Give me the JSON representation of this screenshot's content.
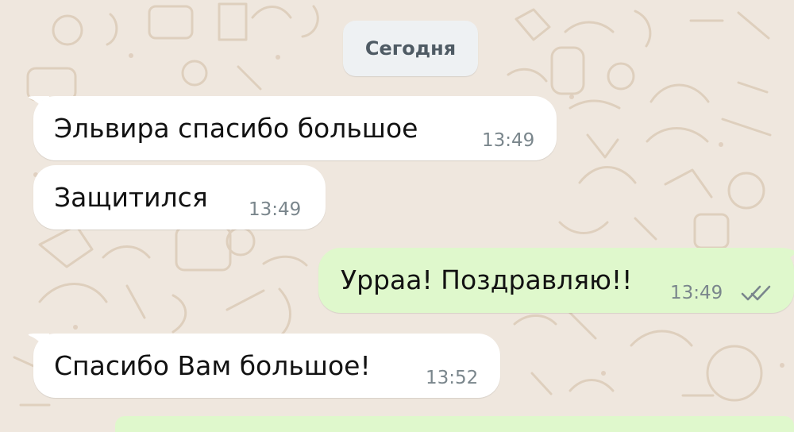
{
  "chat": {
    "date_label": "Сегодня",
    "messages": [
      {
        "direction": "incoming",
        "text": "Эльвира спасибо большое",
        "time": "13:49"
      },
      {
        "direction": "incoming",
        "text": "Защитился",
        "time": "13:49"
      },
      {
        "direction": "outgoing",
        "text": "Урраа! Поздравляю!!",
        "time": "13:49",
        "status_icon": "double-check-icon"
      },
      {
        "direction": "incoming",
        "text": "Спасибо Вам большое!",
        "time": "13:52"
      }
    ]
  },
  "colors": {
    "background": "#efe7de",
    "incoming_bubble": "#ffffff",
    "outgoing_bubble": "#dff8cc",
    "date_chip": "#eef1f3",
    "time_text": "#7a868c",
    "message_text": "#121212"
  }
}
